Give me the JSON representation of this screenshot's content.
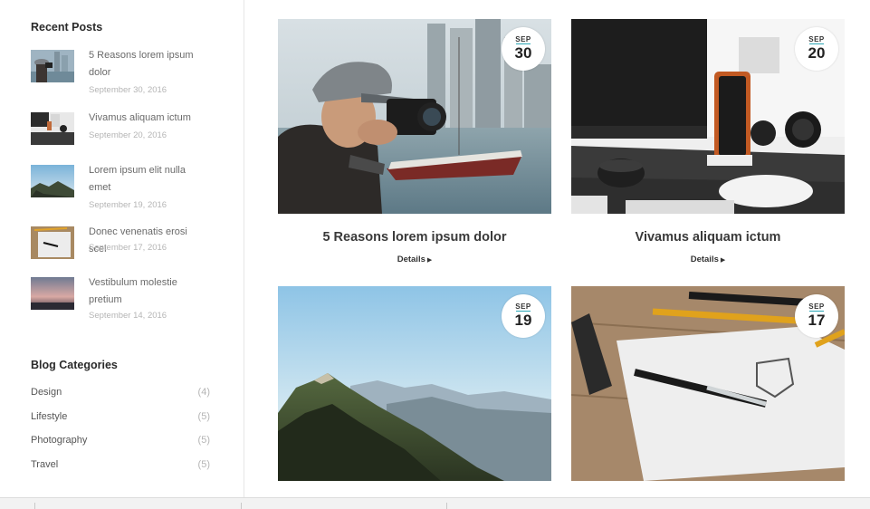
{
  "sidebar": {
    "recent_title": "Recent Posts",
    "recent_posts": [
      {
        "title": "5 Reasons lorem ipsum dolor",
        "date": "September 30, 2016"
      },
      {
        "title": "Vivamus aliquam ictum",
        "date": "September 20, 2016"
      },
      {
        "title": "Lorem ipsum elit nulla emet",
        "date": "September 19, 2016"
      },
      {
        "title": "Donec venenatis erosi scel",
        "date": "September 17, 2016"
      },
      {
        "title": "Vestibulum molestie pretium",
        "date": "September 14, 2016"
      }
    ],
    "categories_title": "Blog Categories",
    "categories": [
      {
        "name": "Design",
        "count": "(4)"
      },
      {
        "name": "Lifestyle",
        "count": "(5)"
      },
      {
        "name": "Photography",
        "count": "(5)"
      },
      {
        "name": "Travel",
        "count": "(5)"
      }
    ]
  },
  "posts": [
    {
      "month": "SEP",
      "day": "30",
      "title": "5 Reasons lorem ipsum dolor",
      "link": "Details",
      "image": "photographer-with-camera"
    },
    {
      "month": "SEP",
      "day": "20",
      "title": "Vivamus aliquam ictum",
      "link": "Details",
      "image": "desk-with-phone-and-headphones"
    },
    {
      "month": "SEP",
      "day": "19",
      "title": "",
      "link": "",
      "image": "mountain-ridge"
    },
    {
      "month": "SEP",
      "day": "17",
      "title": "",
      "link": "",
      "image": "pen-on-sketch-paper"
    }
  ],
  "colors": {
    "accent": "#2aa6b5",
    "muted": "#b5b5b5"
  }
}
